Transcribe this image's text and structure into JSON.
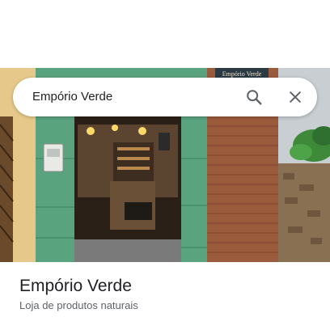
{
  "search": {
    "query": "Empório Verde"
  },
  "storefront": {
    "sign_text": "Empório Verde"
  },
  "place": {
    "title": "Empório Verde",
    "subtitle": "Loja de produtos naturais"
  },
  "icons": {
    "search": "search-icon",
    "close": "close-icon"
  },
  "colors": {
    "facade_green": "#5aa37f",
    "brick": "#9a5a3c",
    "text_primary": "#202124",
    "text_secondary": "#5f6368"
  }
}
